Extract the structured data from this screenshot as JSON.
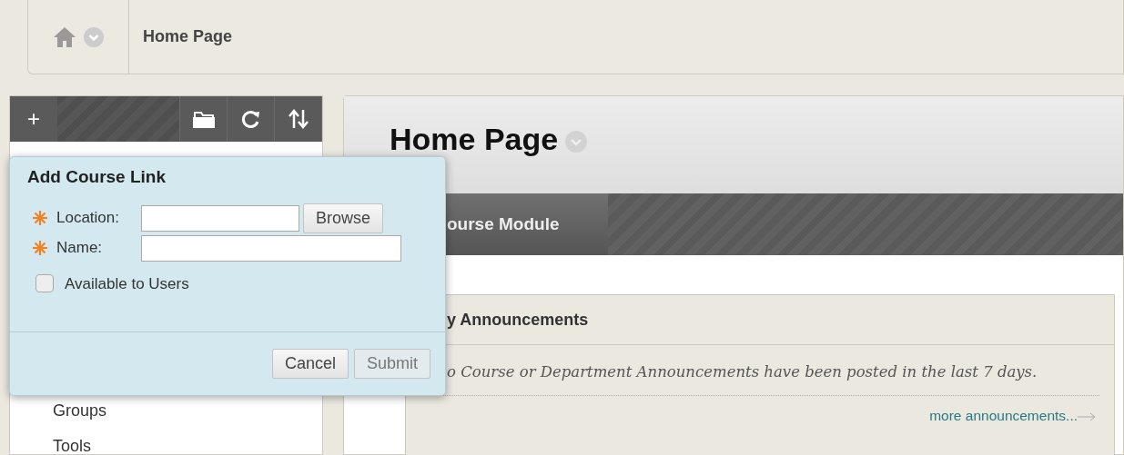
{
  "breadcrumb": {
    "items": [
      "Home Page"
    ]
  },
  "course_menu": {
    "toolbar": {
      "add_label": "+"
    },
    "items": [
      "Groups",
      "Tools"
    ]
  },
  "page": {
    "title": "Home Page",
    "tabs": [
      {
        "label": "ourse Module",
        "selected": true
      }
    ]
  },
  "module": {
    "title": "y Announcements",
    "message": "o Course or Department Announcements have been posted in the last 7 days.",
    "link": "more announcements..."
  },
  "dialog": {
    "title": "Add Course Link",
    "fields": [
      {
        "label": "Location:",
        "required": true,
        "kind": "browse",
        "button": "Browse"
      },
      {
        "label": "Name:",
        "required": true,
        "kind": "text"
      }
    ],
    "options": [
      {
        "label": "Available to Users",
        "checked": false
      }
    ],
    "buttons": [
      {
        "label": "Cancel",
        "kind": "secondary"
      },
      {
        "label": "Submit",
        "kind": "primary"
      }
    ]
  }
}
